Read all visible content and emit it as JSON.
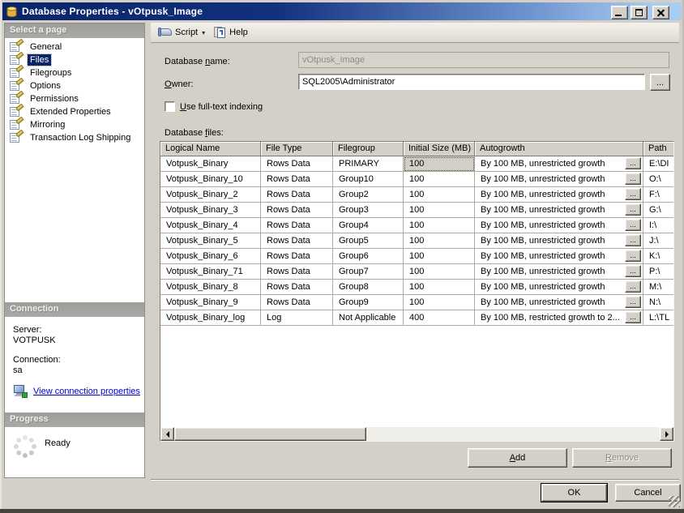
{
  "window": {
    "title": "Database Properties - vOtpusk_Image"
  },
  "toolbar": {
    "script_label": "Script",
    "dropdown_glyph": "▾",
    "help_label": "Help"
  },
  "sidebar": {
    "select_header": "Select a page",
    "pages": [
      {
        "label": "General"
      },
      {
        "label": "Files",
        "selected": true
      },
      {
        "label": "Filegroups"
      },
      {
        "label": "Options"
      },
      {
        "label": "Permissions"
      },
      {
        "label": "Extended Properties"
      },
      {
        "label": "Mirroring"
      },
      {
        "label": "Transaction Log Shipping"
      }
    ],
    "connection_header": "Connection",
    "server_label": "Server:",
    "server_value": "VOTPUSK",
    "connection_label": "Connection:",
    "connection_value": "sa",
    "view_link": "View connection properties",
    "progress_header": "Progress",
    "progress_status": "Ready"
  },
  "form": {
    "database_name_label": {
      "pre": "Database ",
      "key": "n",
      "post": "ame:"
    },
    "database_name_value": "vOtpusk_Image",
    "owner_label": {
      "pre": "",
      "key": "O",
      "post": "wner:"
    },
    "owner_value": "SQL2005\\Administrator",
    "browse_label": "...",
    "fulltext_label": {
      "pre": "",
      "key": "U",
      "post": "se full-text indexing"
    },
    "files_label": {
      "pre": "Database ",
      "key": "f",
      "post": "iles:"
    }
  },
  "table": {
    "headers": [
      "Logical Name",
      "File Type",
      "Filegroup",
      "Initial Size (MB)",
      "Autogrowth",
      "Path"
    ],
    "browse_label": "...",
    "rows": [
      {
        "logical_name": "Votpusk_Binary",
        "file_type": "Rows Data",
        "filegroup": "PRIMARY",
        "initial_size": "100",
        "autogrowth": "By 100 MB, unrestricted growth",
        "path": "E:\\DI"
      },
      {
        "logical_name": "Votpusk_Binary_10",
        "file_type": "Rows Data",
        "filegroup": "Group10",
        "initial_size": "100",
        "autogrowth": "By 100 MB, unrestricted growth",
        "path": "O:\\"
      },
      {
        "logical_name": "Votpusk_Binary_2",
        "file_type": "Rows Data",
        "filegroup": "Group2",
        "initial_size": "100",
        "autogrowth": "By 100 MB, unrestricted growth",
        "path": "F:\\"
      },
      {
        "logical_name": "Votpusk_Binary_3",
        "file_type": "Rows Data",
        "filegroup": "Group3",
        "initial_size": "100",
        "autogrowth": "By 100 MB, unrestricted growth",
        "path": "G:\\"
      },
      {
        "logical_name": "Votpusk_Binary_4",
        "file_type": "Rows Data",
        "filegroup": "Group4",
        "initial_size": "100",
        "autogrowth": "By 100 MB, unrestricted growth",
        "path": "I:\\"
      },
      {
        "logical_name": "Votpusk_Binary_5",
        "file_type": "Rows Data",
        "filegroup": "Group5",
        "initial_size": "100",
        "autogrowth": "By 100 MB, unrestricted growth",
        "path": "J:\\"
      },
      {
        "logical_name": "Votpusk_Binary_6",
        "file_type": "Rows Data",
        "filegroup": "Group6",
        "initial_size": "100",
        "autogrowth": "By 100 MB, unrestricted growth",
        "path": "K:\\"
      },
      {
        "logical_name": "Votpusk_Binary_71",
        "file_type": "Rows Data",
        "filegroup": "Group7",
        "initial_size": "100",
        "autogrowth": "By 100 MB, unrestricted growth",
        "path": "P:\\"
      },
      {
        "logical_name": "Votpusk_Binary_8",
        "file_type": "Rows Data",
        "filegroup": "Group8",
        "initial_size": "100",
        "autogrowth": "By 100 MB, unrestricted growth",
        "path": "M:\\"
      },
      {
        "logical_name": "Votpusk_Binary_9",
        "file_type": "Rows Data",
        "filegroup": "Group9",
        "initial_size": "100",
        "autogrowth": "By 100 MB, unrestricted growth",
        "path": "N:\\"
      },
      {
        "logical_name": "Votpusk_Binary_log",
        "file_type": "Log",
        "filegroup": "Not Applicable",
        "initial_size": "400",
        "autogrowth": "By 100 MB, restricted growth to 2...",
        "path": "L:\\TL"
      }
    ]
  },
  "buttons": {
    "add": {
      "pre": "",
      "key": "A",
      "post": "dd"
    },
    "remove": {
      "pre": "",
      "key": "R",
      "post": "emove"
    },
    "ok": "OK",
    "cancel": "Cancel"
  }
}
